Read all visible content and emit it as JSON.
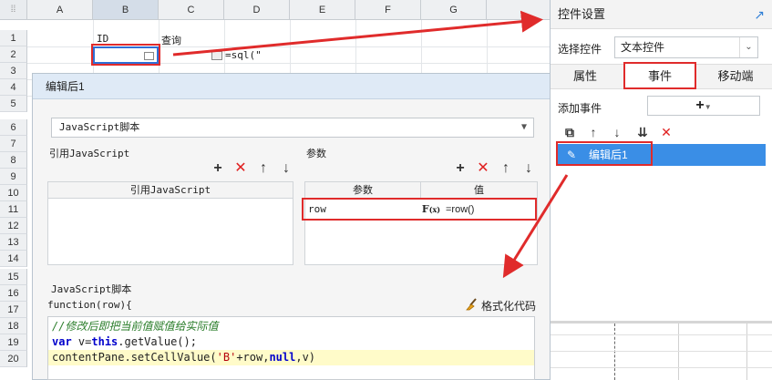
{
  "sheet": {
    "columns": [
      "A",
      "B",
      "C",
      "D",
      "E",
      "F",
      "G"
    ],
    "rows": [
      "1",
      "2",
      "3",
      "4",
      "5",
      "6",
      "7",
      "8",
      "9",
      "10",
      "11",
      "12",
      "13",
      "14",
      "15",
      "16",
      "17",
      "18",
      "19",
      "20"
    ],
    "cells": {
      "b1": "ID",
      "c1": "查询",
      "d2": "=sql(\""
    }
  },
  "dialog": {
    "title": "编辑后1",
    "script_type": "JavaScript脚本",
    "ref_js_label": "引用JavaScript",
    "params_label": "参数",
    "ref_js_col": "引用JavaScript",
    "param_col": "参数",
    "value_col": "值",
    "param_name": "row",
    "param_value": "=row()",
    "script_label": "JavaScript脚本",
    "function_sig": "function(row){",
    "format_label": "格式化代码",
    "code": {
      "comment": "//修改后即把当前值赋值给实际值",
      "l2_kw1": "var",
      "l2_mid": " v=",
      "l2_kw2": "this",
      "l2_rest": ".getValue();",
      "l3_a": "contentPane.setCellValue(",
      "l3_str": "'B'",
      "l3_b": "+row,",
      "l3_kw": "null",
      "l3_c": ",v)"
    }
  },
  "panel": {
    "title": "控件设置",
    "select_label": "选择控件",
    "select_value": "文本控件",
    "tabs": [
      "属性",
      "事件",
      "移动端"
    ],
    "add_event_label": "添加事件",
    "event_item": "编辑后1"
  },
  "colors": {
    "accent": "#3a8ee6",
    "arrow": "#e02b2b",
    "header": "#dfeaf6"
  }
}
